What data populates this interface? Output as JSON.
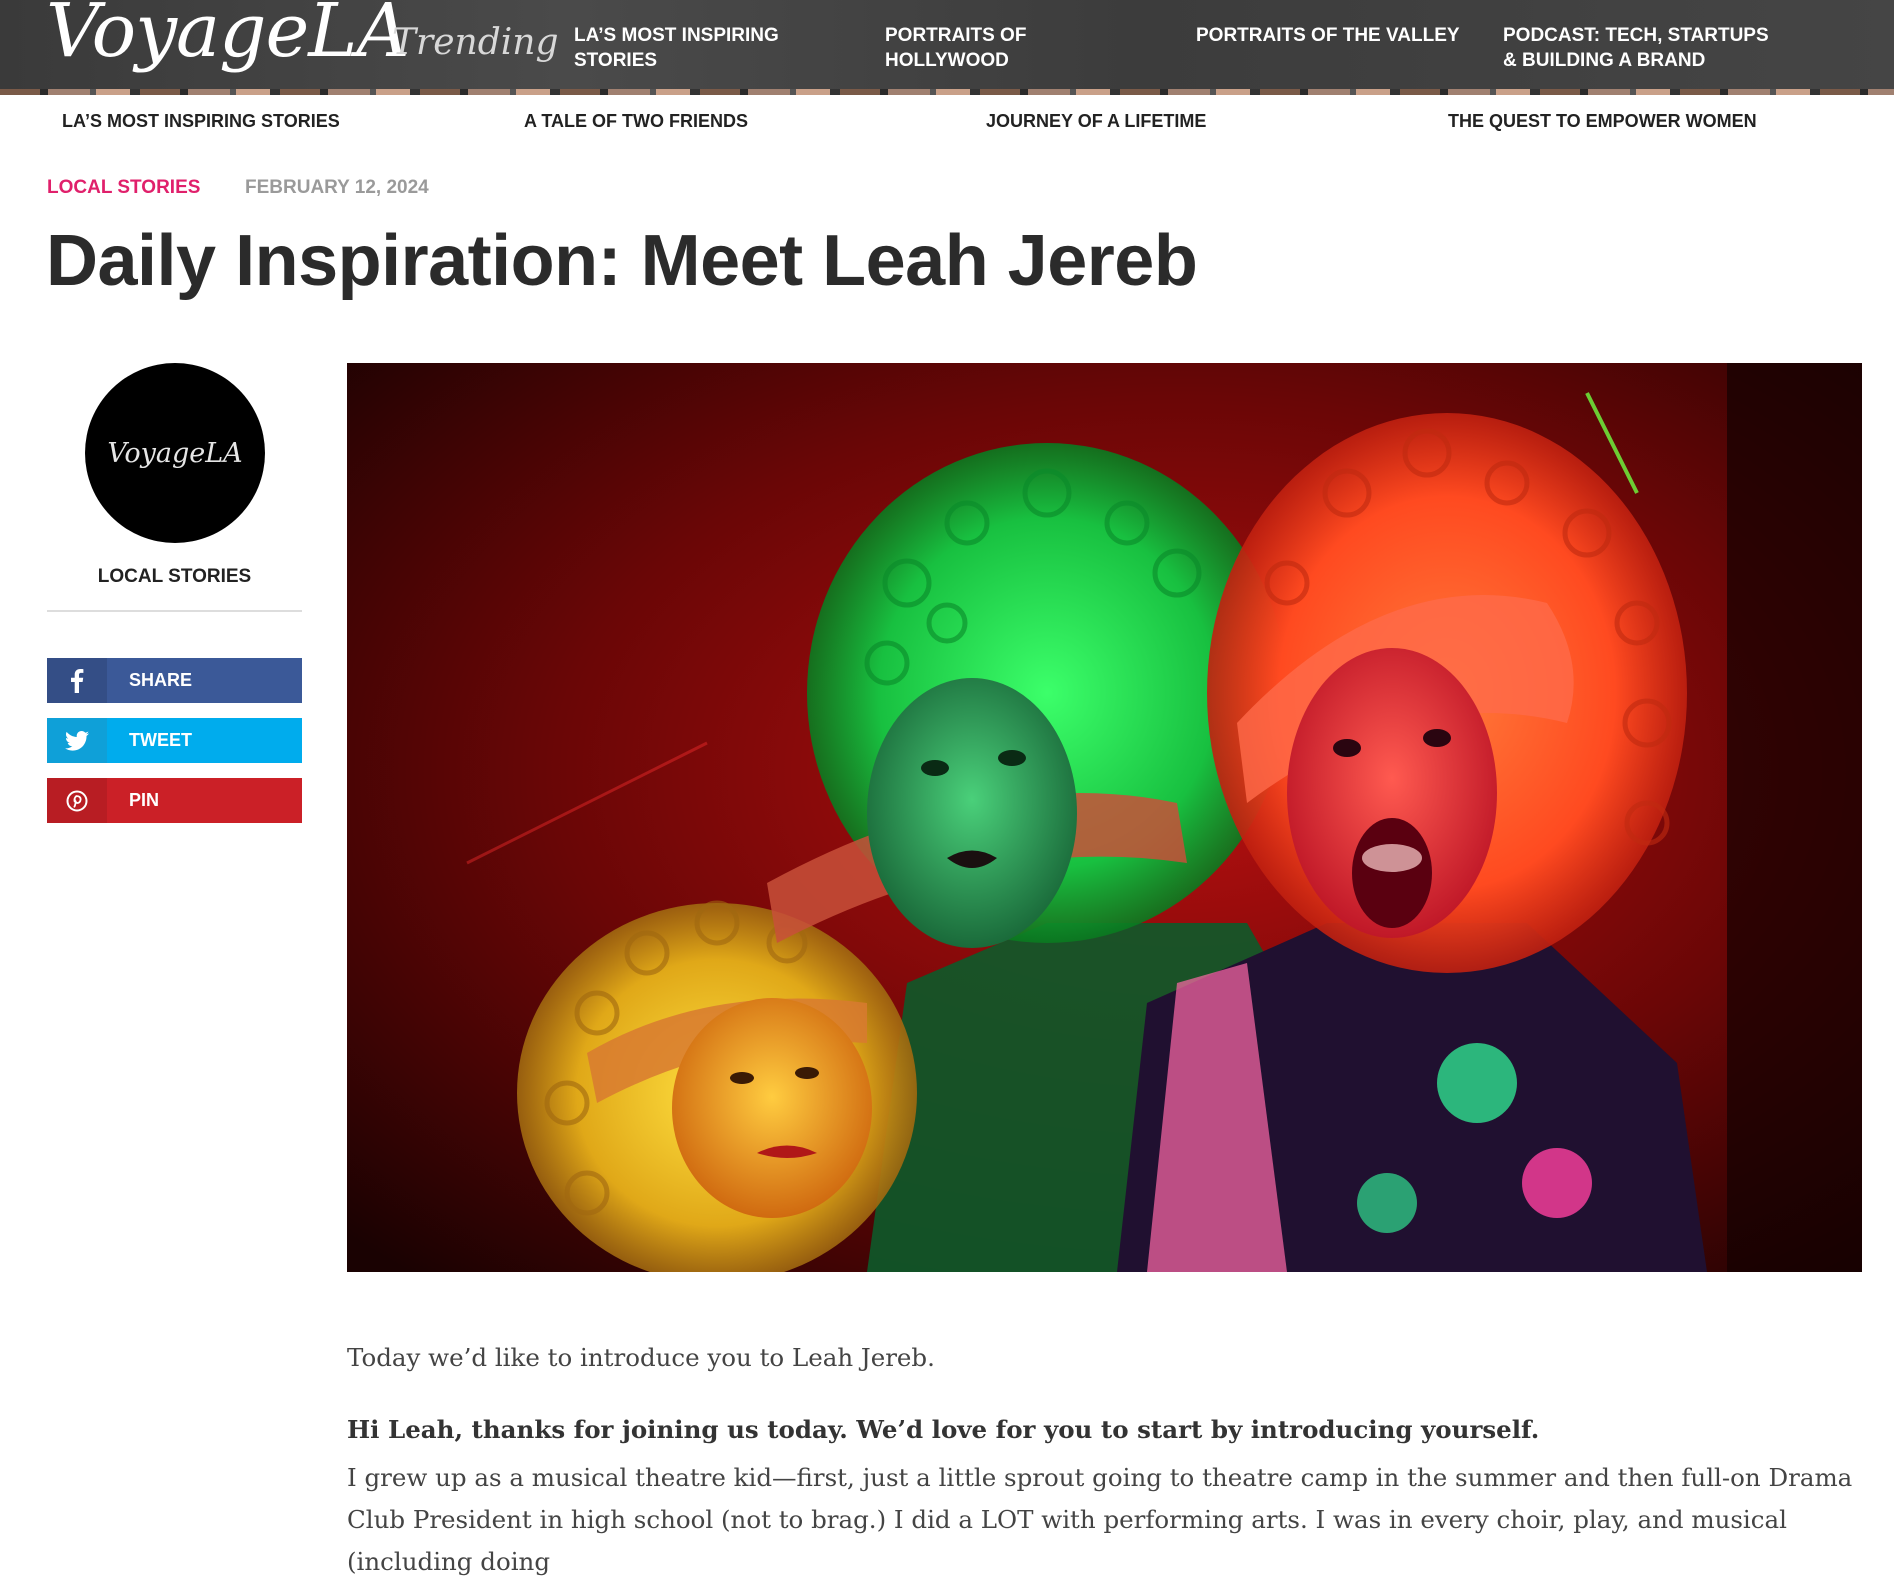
{
  "site": {
    "logo": "VoyageLA",
    "trending_label": "Trending"
  },
  "topnav": {
    "items": [
      {
        "label": "LA’S MOST INSPIRING STORIES"
      },
      {
        "label": "PORTRAITS OF HOLLYWOOD"
      },
      {
        "label": "PORTRAITS OF THE VALLEY"
      },
      {
        "label": "PODCAST: TECH, STARTUPS & BUILDING A BRAND"
      }
    ]
  },
  "subnav": {
    "items": [
      {
        "label": "LA’S MOST INSPIRING STORIES"
      },
      {
        "label": "A TALE OF TWO FRIENDS"
      },
      {
        "label": "JOURNEY OF A LIFETIME"
      },
      {
        "label": "THE QUEST TO EMPOWER WOMEN"
      }
    ]
  },
  "article": {
    "category": "LOCAL STORIES",
    "date": "FEBRUARY 12, 2024",
    "title": "Daily Inspiration: Meet Leah Jereb",
    "intro": "Today we’d like to introduce you to Leah Jereb.",
    "question": "Hi Leah, thanks for joining us today. We’d love for you to start by introducing yourself.",
    "answer": "I grew up as a musical theatre kid—first, just a little sprout going to theatre camp in the summer and then full-on Drama Club President in high school (not to brag.) I did a LOT with performing arts. I was in every choir, play, and musical (including doing"
  },
  "sidebar": {
    "avatar_text": "VoyageLA",
    "category": "LOCAL STORIES",
    "share": [
      {
        "label": "SHARE",
        "icon": "facebook-icon"
      },
      {
        "label": "TWEET",
        "icon": "twitter-icon"
      },
      {
        "label": "PIN",
        "icon": "pinterest-icon"
      }
    ]
  },
  "colors": {
    "category_accent": "#e0206b",
    "facebook": "#3b5998",
    "twitter": "#00aced",
    "pinterest": "#cb2027"
  }
}
